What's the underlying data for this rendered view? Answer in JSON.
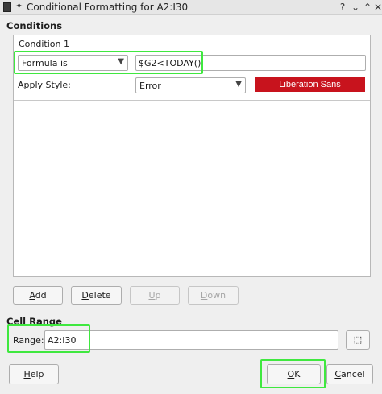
{
  "window": {
    "title": "Conditional Formatting for A2:I30",
    "controls": [
      "?",
      "⌄",
      "⌃",
      "✕"
    ]
  },
  "conditions": {
    "heading": "Conditions",
    "condition_title": "Condition 1",
    "type_value": "Formula is",
    "formula_value": "$G2<TODAY()",
    "apply_style_label": "Apply Style:",
    "style_value": "Error",
    "style_preview": "Liberation Sans",
    "preview_color": "#c8131d"
  },
  "buttons": {
    "add": "Add",
    "delete": "Delete",
    "up": "Up",
    "down": "Down"
  },
  "cell_range": {
    "heading": "Cell Range",
    "range_label": "Range:",
    "range_value": "A2:I30"
  },
  "footer": {
    "help": "Help",
    "ok": "OK",
    "cancel": "Cancel"
  },
  "highlight_color": "#3fe83f"
}
